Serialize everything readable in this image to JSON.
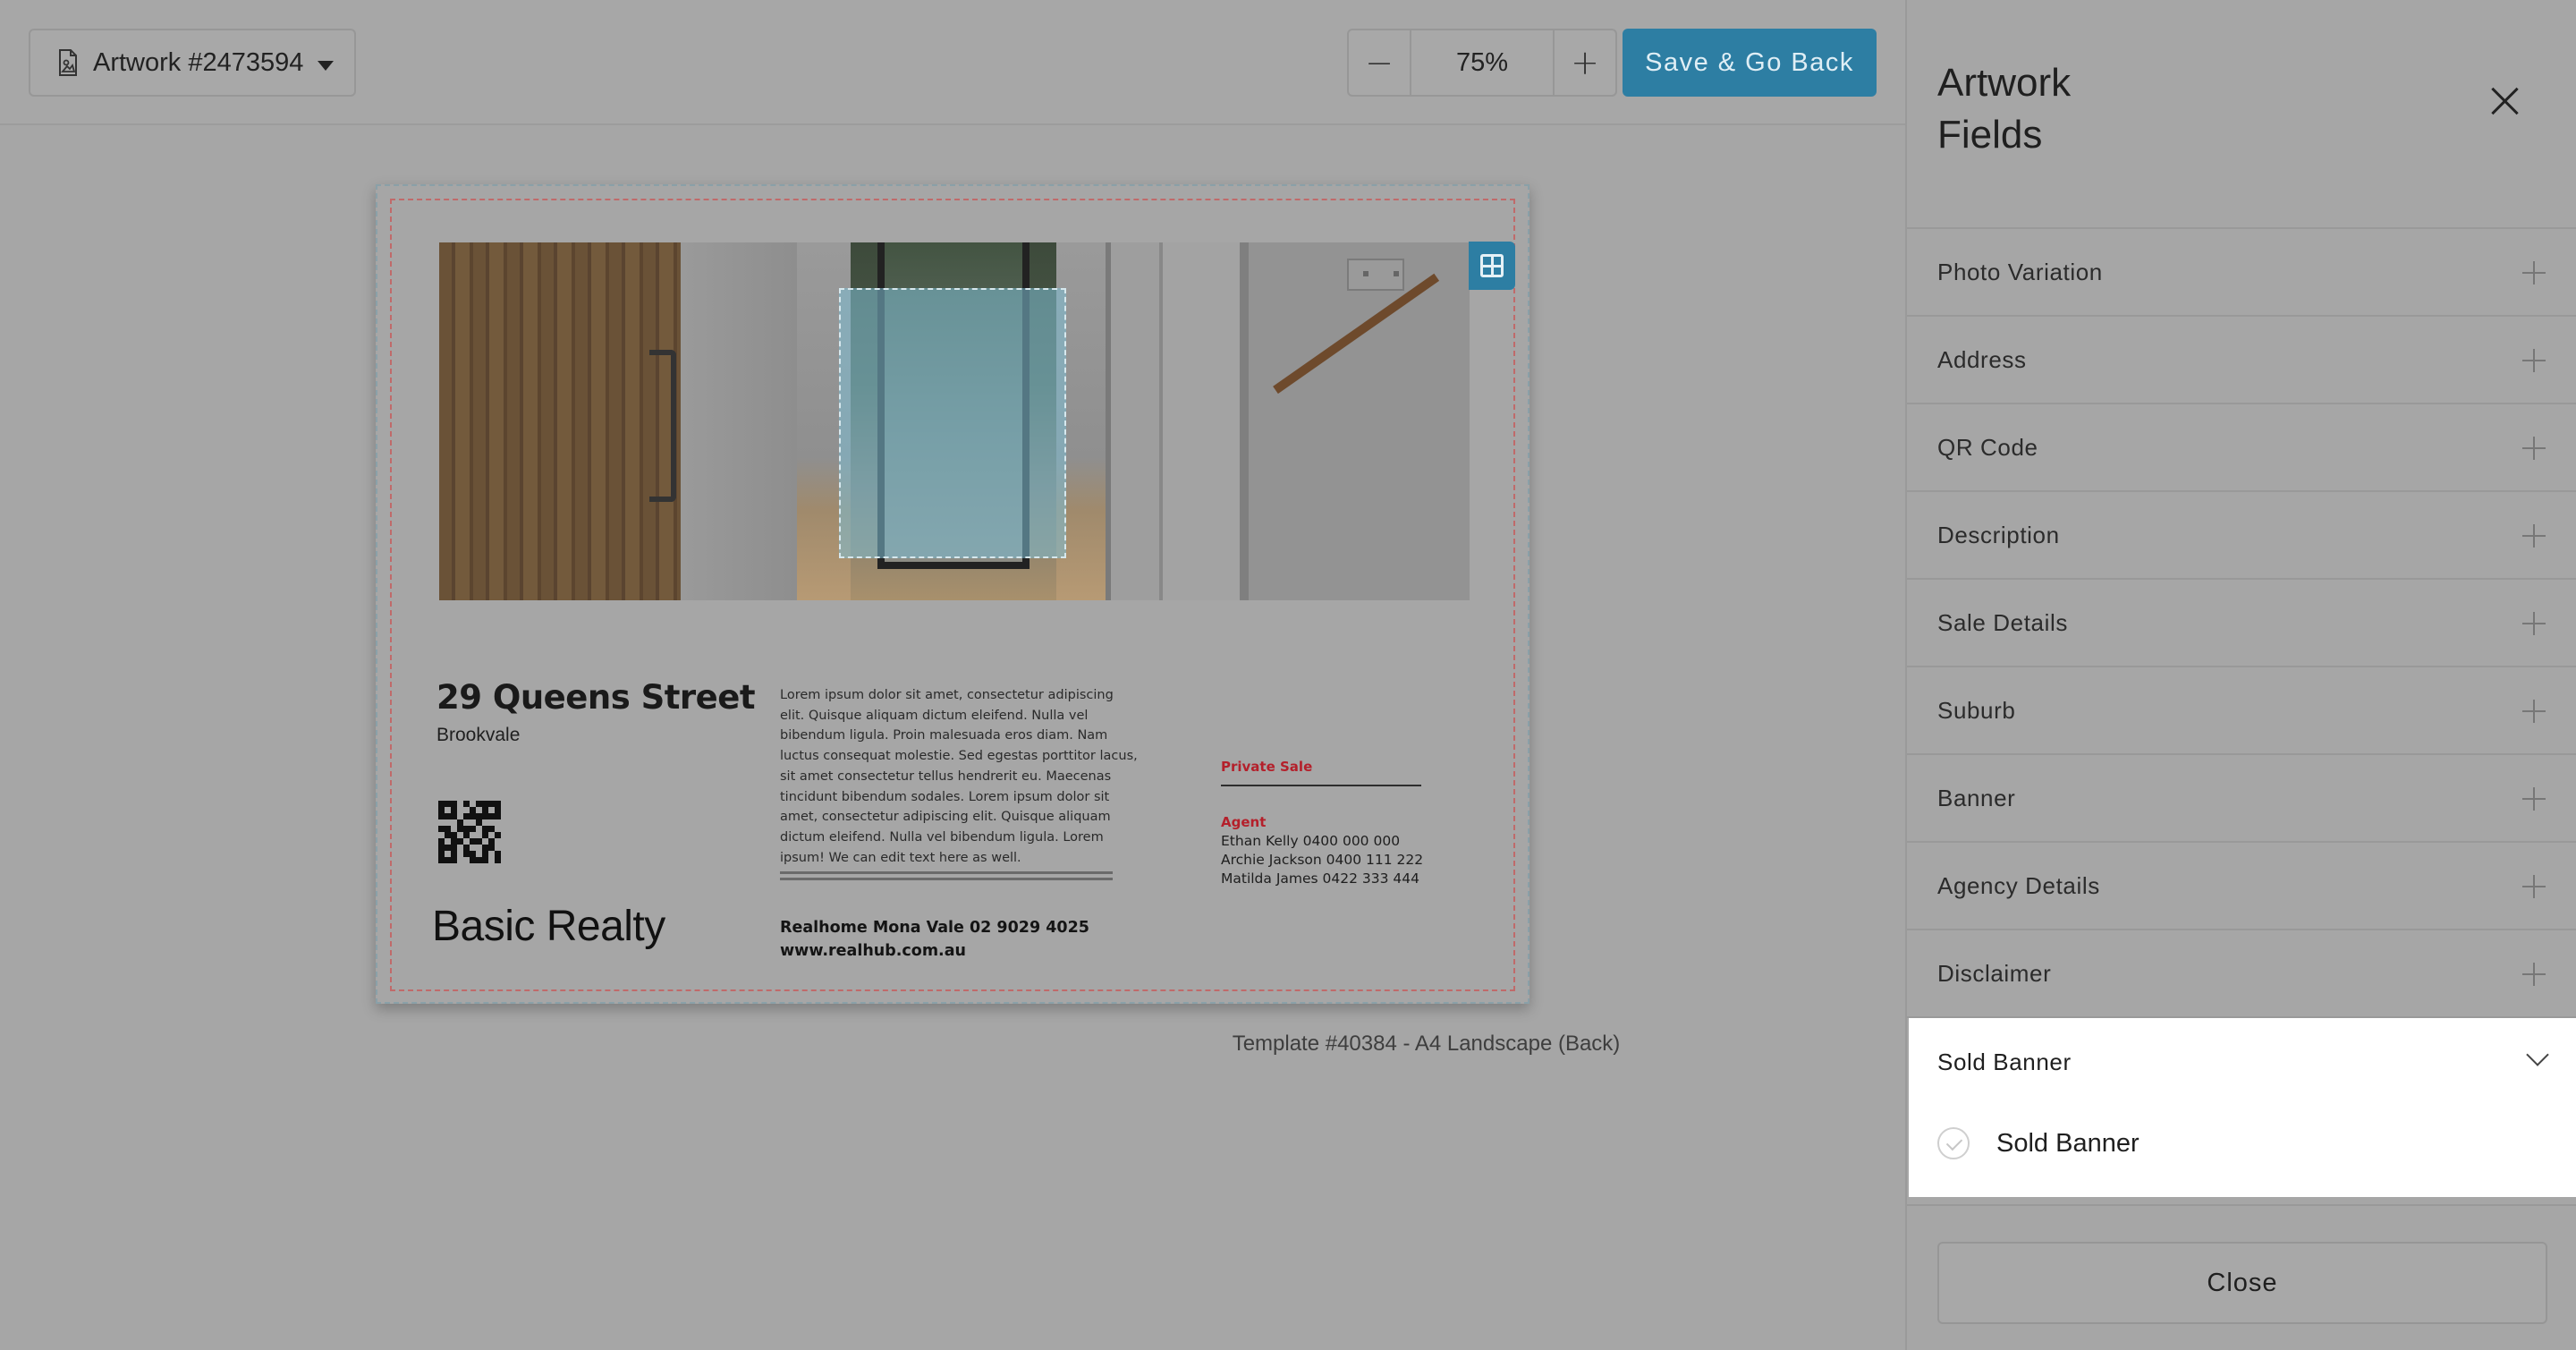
{
  "toolbar": {
    "artwork_label": "Artwork #2473594",
    "zoom_value": "75%",
    "save_label": "Save & Go Back"
  },
  "artwork": {
    "address_title": "29 Queens Street",
    "suburb": "Brookvale",
    "logo_text": "Basic Realty",
    "description": "Lorem ipsum dolor sit amet, consectetur adipiscing elit. Quisque aliquam dictum eleifend. Nulla vel bibendum ligula. Proin malesuada eros diam. Nam luctus consequat molestie. Sed egestas porttitor lacus, sit amet consectetur tellus hendrerit eu. Maecenas tincidunt bibendum sodales. Lorem ipsum dolor sit amet, consectetur adipiscing elit. Quisque aliquam dictum eleifend. Nulla vel bibendum ligula.  Lorem ipsum! We can edit text here as well.",
    "agency_line1": "Realhome Mona Vale 02 9029 4025",
    "agency_line2": "www.realhub.com.au",
    "sale_details": "Private Sale",
    "agent_label": "Agent",
    "agents": [
      "Ethan Kelly 0400 000 000",
      "Archie Jackson 0400 111 222",
      "Matilda James 0422 333 444"
    ],
    "template_caption": "Template #40384 - A4 Landscape (Back)"
  },
  "panel": {
    "title": "Artwork Fields",
    "fields": [
      "Photo Variation",
      "Address",
      "QR Code",
      "Description",
      "Sale Details",
      "Suburb",
      "Banner",
      "Agency Details",
      "Disclaimer"
    ],
    "expanded": {
      "header": "Sold Banner",
      "option_label": "Sold Banner"
    },
    "close_label": "Close"
  },
  "colors": {
    "accent": "#2d7ea3",
    "sale_red": "#b4202b"
  },
  "icons": [
    "document-icon",
    "caret-down-icon",
    "minus-icon",
    "plus-icon",
    "grid-frame-icon",
    "close-icon",
    "chevron-down-icon",
    "check-circle-icon"
  ]
}
